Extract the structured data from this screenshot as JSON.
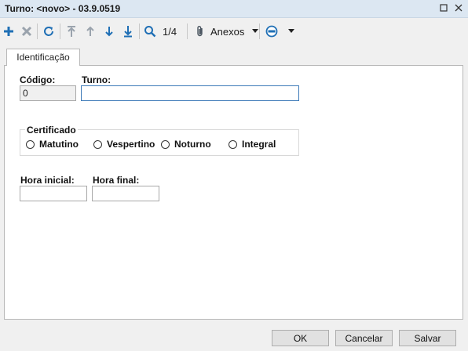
{
  "window": {
    "title": "Turno: <novo> - 03.9.0519"
  },
  "toolbar": {
    "record_position": "1/4",
    "attachments_label": "Anexos"
  },
  "tabs": [
    {
      "label": "Identificação"
    }
  ],
  "form": {
    "codigo": {
      "label": "Código:",
      "value": "0"
    },
    "turno": {
      "label": "Turno:",
      "value": ""
    },
    "certificado": {
      "label": "Certificado",
      "options": [
        "Matutino",
        "Vespertino",
        "Noturno",
        "Integral"
      ]
    },
    "hora_inicial": {
      "label": "Hora inicial:",
      "value": ""
    },
    "hora_final": {
      "label": "Hora final:",
      "value": ""
    }
  },
  "buttons": {
    "ok": "OK",
    "cancel": "Cancelar",
    "save": "Salvar"
  },
  "colors": {
    "toolbar_icon_blue": "#1f6fb5",
    "toolbar_icon_gray": "#9aa3ad",
    "titlebar": "#dce7f2"
  }
}
